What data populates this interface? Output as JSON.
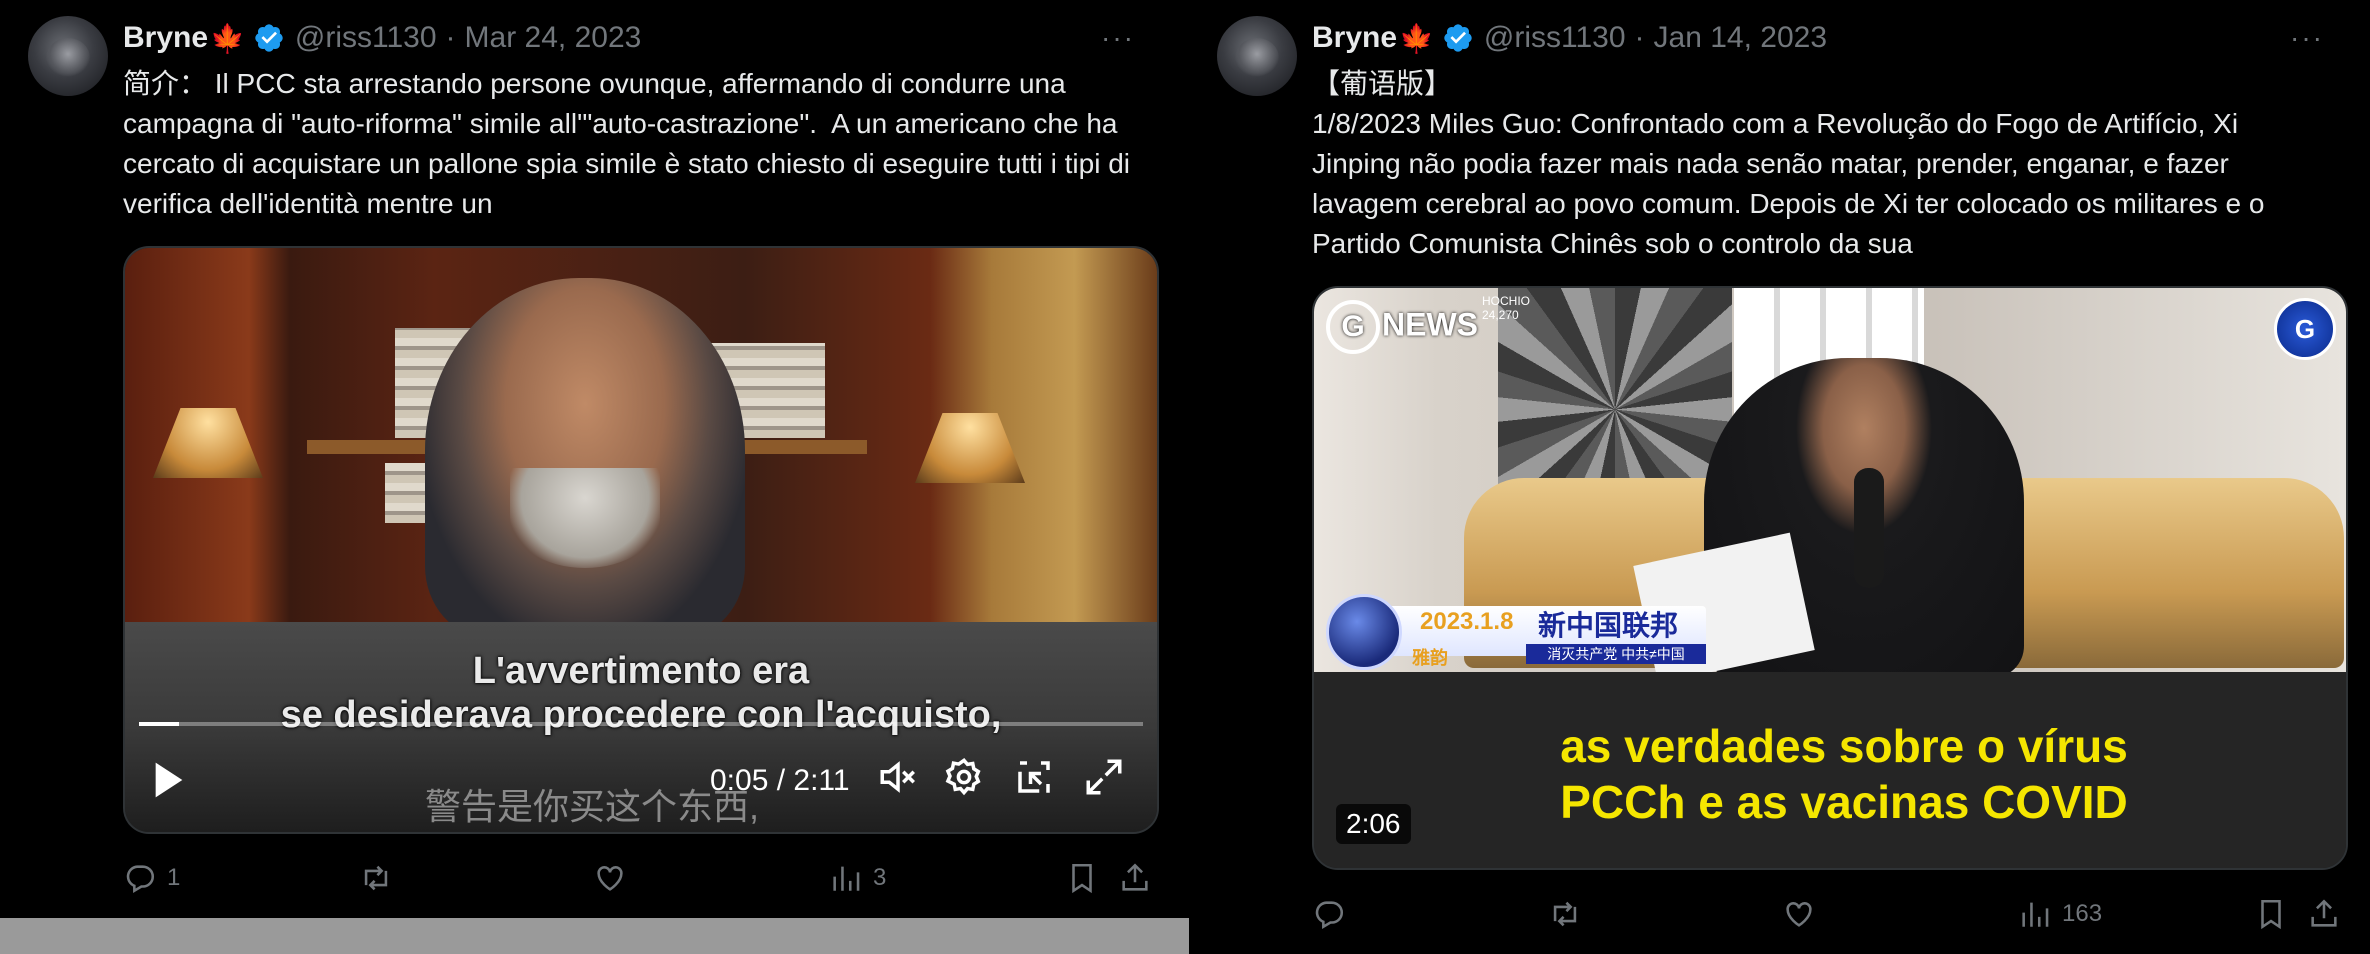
{
  "tweets": [
    {
      "author": {
        "name": "Bryne",
        "flag": "🍁",
        "handle": "@riss1130",
        "date": "Mar 24, 2023"
      },
      "text": "简介： Il PCC sta arrestando persone ovunque, affermando di condurre una campagna di \"auto-riforma\" simile all'\"auto-castrazione\".  A un americano che ha cercato di acquistare un pallone spia simile è stato chiesto di eseguire tutti i tipi di verifica dell'identità mentre un",
      "video": {
        "subtitle_line1": "L'avvertimento era",
        "subtitle_line2": "se desiderava procedere con l'acquisto,",
        "subtitle_cn": "警告是你买这个东西,",
        "time": "0:05 / 2:11",
        "progress": 0.04
      },
      "stats": {
        "replies": "1",
        "retweets": "",
        "likes": "",
        "views": "3"
      }
    },
    {
      "author": {
        "name": "Bryne",
        "flag": "🍁",
        "handle": "@riss1130",
        "date": "Jan 14, 2023"
      },
      "text": "【葡语版】\n1/8/2023 Miles Guo: Confrontado com a Revolução do Fogo de Artifício, Xi Jinping não podia fazer mais nada senão matar, prender, enganar, e fazer lavagem cerebral ao povo comum. Depois de Xi ter colocado os militares e o Partido Comunista Chinês sob o controlo da sua",
      "video": {
        "logo": "NEWS",
        "logo_letter": "G",
        "overlay_top": "HOCHIO\n24,270",
        "badge": "G",
        "banner_date": "2023.1.8",
        "banner_title": "新中国联邦",
        "banner_tag": "雅韵",
        "banner_sub": "消灭共产党    中共≠中国",
        "subtitle": "as verdades sobre o vírus PCCh e as vacinas COVID",
        "duration": "2:06"
      },
      "stats": {
        "replies": "",
        "retweets": "",
        "likes": "",
        "views": "163"
      }
    }
  ],
  "icons": {
    "verified_color": "#1d9bf0",
    "action_color": "#71767b"
  }
}
